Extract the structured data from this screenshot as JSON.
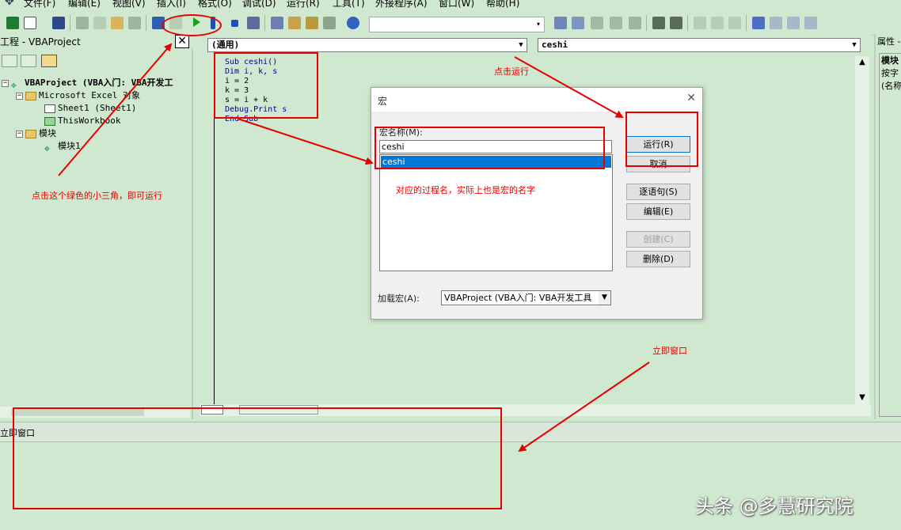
{
  "menu": [
    "文件(F)",
    "编辑(E)",
    "视图(V)",
    "插入(I)",
    "格式(O)",
    "调试(D)",
    "运行(R)",
    "工具(T)",
    "外接程序(A)",
    "窗口(W)",
    "帮助(H)"
  ],
  "project": {
    "title": "工程 - VBAProject",
    "close": "✕",
    "tree": [
      {
        "label": "VBAProject (VBA入门: VBA开发工",
        "level": 0,
        "icon": "vba"
      },
      {
        "label": "Microsoft Excel 对象",
        "level": 1,
        "icon": "folder"
      },
      {
        "label": "Sheet1 (Sheet1)",
        "level": 2,
        "icon": "sheet"
      },
      {
        "label": "ThisWorkbook",
        "level": 2,
        "icon": "workbook"
      },
      {
        "label": "模块",
        "level": 1,
        "icon": "folder"
      },
      {
        "label": "模块1",
        "level": 2,
        "icon": "module"
      }
    ]
  },
  "code": {
    "object_combo": "(通用)",
    "proc_combo": "ceshi",
    "lines": [
      "Sub ceshi()",
      "Dim i, k, s",
      "i = 2",
      "k = 3",
      "s = i + k",
      "Debug.Print s",
      "End Sub"
    ]
  },
  "props": {
    "title": "属性 -",
    "items": [
      "模块",
      "按字",
      "(名称"
    ]
  },
  "immediate": {
    "title": "立即窗口"
  },
  "dialog": {
    "title": "宏",
    "close": "✕",
    "name_label": "宏名称(M):",
    "name_value": "ceshi",
    "list_items": [
      "ceshi"
    ],
    "buttons": {
      "run": "运行(R)",
      "cancel": "取消",
      "step": "逐语句(S)",
      "edit": "编辑(E)",
      "create": "创建(C)",
      "delete": "删除(D)"
    },
    "macros_in_label": "加载宏(A):",
    "macros_in_value": "VBAProject (VBA入门: VBA开发工具"
  },
  "annotations": {
    "run_click": "点击运行",
    "green_triangle": "点击这个绿色的小三角，即可运行",
    "proc_name": "对应的过程名，实际上也是宏的名字",
    "immediate": "立即窗口"
  },
  "watermark": "头条 @多慧研究院",
  "colors": {
    "accent_red": "#e60000",
    "selection_blue": "#0078d7",
    "background_green": "#cfe8cf"
  }
}
